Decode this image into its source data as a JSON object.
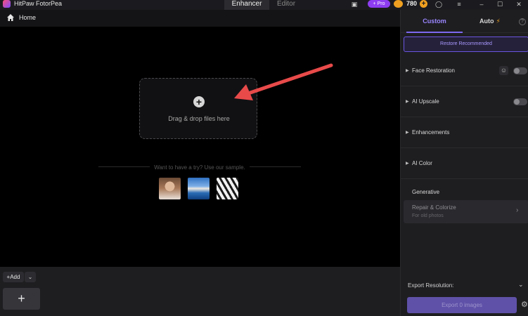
{
  "app": {
    "name": "HitPaw FotorPea",
    "tabs": [
      {
        "label": "Enhancer",
        "active": true
      },
      {
        "label": "Editor",
        "active": false
      }
    ],
    "pro_label": "+ Pro",
    "credits": "780"
  },
  "header": {
    "home_label": "Home"
  },
  "canvas": {
    "drop_text": "Drag & drop files here",
    "sample_text": "Want to have a try? Use our sample."
  },
  "tray": {
    "add_label": "Add"
  },
  "panel": {
    "tabs": {
      "custom": "Custom",
      "auto": "Auto"
    },
    "restore_label": "Restore Recommended",
    "sections": [
      {
        "label": "Face Restoration"
      },
      {
        "label": "AI Upscale"
      },
      {
        "label": "Enhancements"
      },
      {
        "label": "AI Color"
      }
    ],
    "generative": {
      "label": "Generative",
      "card_title": "Repair & Colorize",
      "card_subtitle": "For old photos"
    },
    "export": {
      "resolution_label": "Export Resolution:",
      "button_label": "Export 0 images"
    }
  },
  "colors": {
    "accent": "#7c68f0",
    "pro_badge": "#8e3df2",
    "coin": "#f0a020",
    "arrow": "#e84a4a"
  }
}
